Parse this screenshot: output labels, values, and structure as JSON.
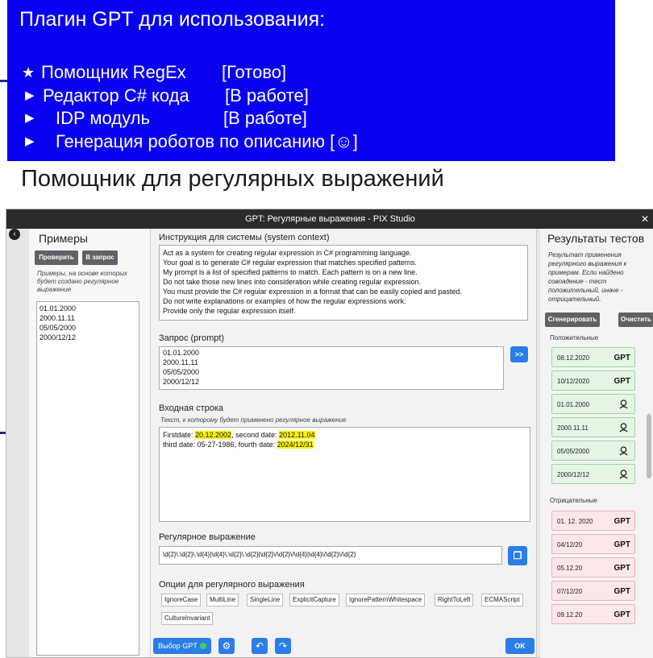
{
  "slide": {
    "banner_title": "Плагин GPT  для использования:",
    "plan_items": [
      {
        "mark": "★",
        "name": "Помощник RegEx",
        "status": "[Готово]"
      },
      {
        "mark": "▶",
        "name": "Редактор C# кода",
        "status": "[В работе]"
      },
      {
        "mark": "▶",
        "name": "IDP модуль",
        "status": "[В работе]"
      },
      {
        "mark": "▶",
        "name": "Генерация роботов по описанию [☺]",
        "status": ""
      }
    ],
    "subheading": "Помощник для регулярных выражений"
  },
  "window": {
    "title": "GPT: Регулярные выражения - PIX Studio",
    "close_glyph": "✕",
    "back_glyph": "‹"
  },
  "examples_panel": {
    "title": "Примеры",
    "check_button": "Проверить",
    "to_request_button": "В запрос",
    "hint": "Примеры, на основе которых будет создано регулярное выражение",
    "items": [
      "01.01.2000",
      "2000.11.11",
      "05/05/2000",
      "2000/12/12"
    ]
  },
  "main": {
    "system_title": "Инструкция для системы (system context)",
    "system_lines": [
      "Act as a system for creating regular expression in C# programming language.",
      "Your goal is to generate C# regular expression that matches specified patterns.",
      "My prompt is a list of specified patterns to match. Each pattern is on a new line.",
      "Do not take those new lines into consideration while creating regular expression.",
      "You must provide the C# regular expression in a format that can be easily copied and pasted.",
      "Do not write explanations or examples of how the regular expressions work.",
      "Provide only the regular expression itself."
    ],
    "prompt_title": "Запрос (prompt)",
    "prompt_lines": [
      "01.01.2000",
      "2000.11.11",
      "05/05/2000",
      "2000/12/12"
    ],
    "send_button": ">>",
    "input_title": "Входная строка",
    "input_hint": "Текст, к которому будет применено регулярное выражение",
    "input_line1": {
      "a": "Firstdate: ",
      "m1": "20.12.2002",
      "b": ", second date: ",
      "m2": "2012.11.04"
    },
    "input_line2": {
      "a": "third date: 05-27-1986, fourth date: ",
      "m1": "2024/12/31"
    },
    "regex_title": "Регулярное выражение",
    "regex_value": "\\d{2}\\.\\d{2}\\.\\d{4}|\\d{4}\\.\\d{2}\\.\\d{2}|\\d{2}\\/\\d{2}\\/\\d{4}|\\d{4}\\/\\d{2}\\/\\d{2}",
    "copy_icon": "❐",
    "options_title": "Опции для регулярного выражения",
    "options": [
      "IgnoreCase",
      "MultiLine",
      "SingleLine",
      "ExplicitCapture",
      "IgnorePatternWhitespace",
      "RightToLeft",
      "ECMAScript",
      "CultureInvariant"
    ]
  },
  "bottom_bar": {
    "gpt_select": "Выбор GPT",
    "settings_icon": "⚙",
    "undo_icon": "↶",
    "redo_icon": "↷",
    "ok_button": "OK"
  },
  "results": {
    "title": "Результаты тестов",
    "description": "Результат применения регулярного выражения к примерам. Если найдено совпадение - тест положительный, иначе - отрицательный.",
    "generate_button": "Сгенерировать",
    "clear_button": "Очистить",
    "positive_label": "Положительные",
    "positive": [
      {
        "value": "08.12.2020",
        "tag": "GPT"
      },
      {
        "value": "10/12/2020",
        "tag": "GPT"
      },
      {
        "value": "01.01.2000",
        "tag": ""
      },
      {
        "value": "2000.11.11",
        "tag": ""
      },
      {
        "value": "05/05/2000",
        "tag": ""
      },
      {
        "value": "2000/12/12",
        "tag": ""
      }
    ],
    "negative_label": "Отрицательные",
    "negative": [
      {
        "value": "01. 12. 2020",
        "tag": "GPT"
      },
      {
        "value": "04/12/20",
        "tag": "GPT"
      },
      {
        "value": "05.12.20",
        "tag": "GPT"
      },
      {
        "value": "07/12/20",
        "tag": "GPT"
      },
      {
        "value": "09.12.20",
        "tag": "GPT"
      }
    ]
  },
  "colors": {
    "banner_bg": "#0a00f0",
    "accent_blue": "#2b7de9",
    "highlight": "#fff200",
    "positive_bg": "#e4f5e4",
    "negative_bg": "#fbe6ea"
  }
}
